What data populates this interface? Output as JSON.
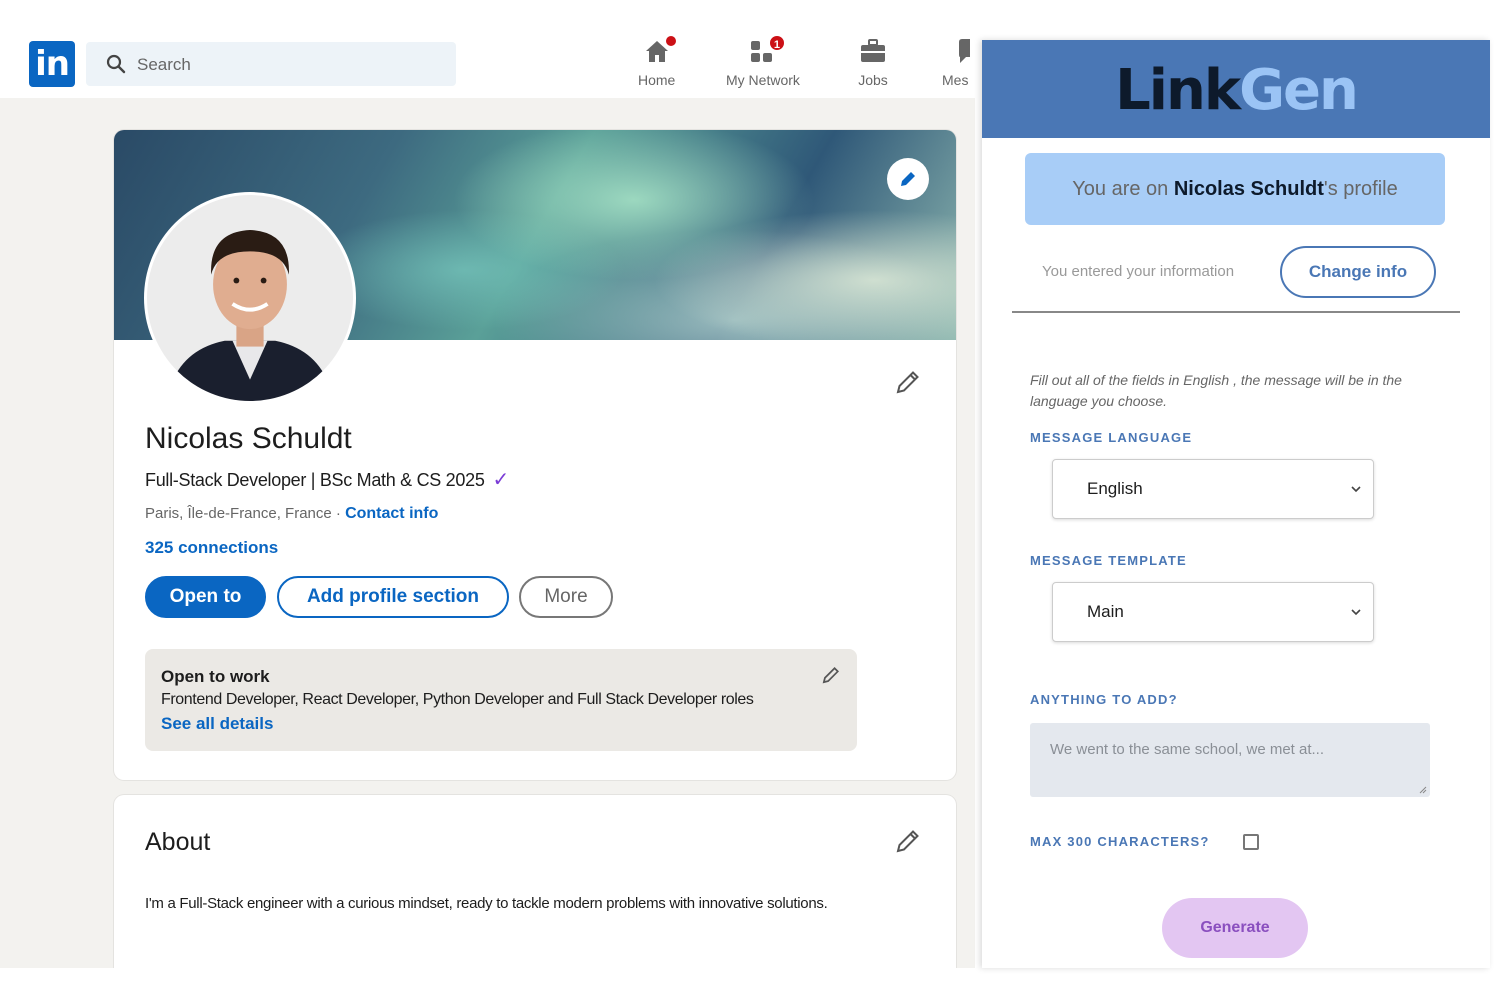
{
  "linkedin": {
    "logo": "in",
    "search": {
      "placeholder": "Search",
      "icon": "search-icon"
    },
    "nav": [
      {
        "label": "Home",
        "icon": "home-icon",
        "badge": ""
      },
      {
        "label": "My Network",
        "icon": "network-icon",
        "badge": "1"
      },
      {
        "label": "Jobs",
        "icon": "briefcase-icon",
        "badge": ""
      },
      {
        "label": "Mes",
        "icon": "messaging-icon",
        "badge": ""
      }
    ],
    "profile": {
      "name": "Nicolas Schuldt",
      "headline": "Full-Stack Developer | BSc Math & CS 2025",
      "verified_mark": "✓",
      "location": "Paris, Île-de-France, France · ",
      "contact_link": "Contact info",
      "connections": "325 connections",
      "buttons": {
        "open_to": "Open to",
        "add_section": "Add profile section",
        "more": "More"
      },
      "open_to_work": {
        "title": "Open to work",
        "roles": "Frontend Developer, React Developer, Python Developer and Full Stack Developer roles",
        "link": "See all details"
      }
    },
    "about": {
      "title": "About",
      "text": "I'm a Full-Stack engineer with a curious mindset, ready to tackle modern problems with innovative solutions."
    },
    "colors": {
      "brand": "#0a66c2",
      "badge": "#cc1016"
    }
  },
  "linkgen": {
    "title_part1": "Link",
    "title_part2": "Gen",
    "profile_prefix": "You are on ",
    "profile_name": "Nicolas Schuldt",
    "profile_suffix": "'s profile",
    "entered_info": "You entered your information",
    "change_info": "Change info",
    "note": "Fill out all of the fields in English , the message will be in the language you choose.",
    "language_label": "MESSAGE LANGUAGE",
    "language_value": "English",
    "template_label": "MESSAGE TEMPLATE",
    "template_value": "Main",
    "anything_label": "ANYTHING TO ADD?",
    "anything_placeholder": "We went to the same school, we met at...",
    "max_chars_label": "MAX 300 CHARACTERS?",
    "max_chars_checked": false,
    "generate": "Generate",
    "colors": {
      "header": "#4a77b5",
      "profile_box": "#a8cdf7",
      "generate": "#e3c6f2"
    }
  }
}
